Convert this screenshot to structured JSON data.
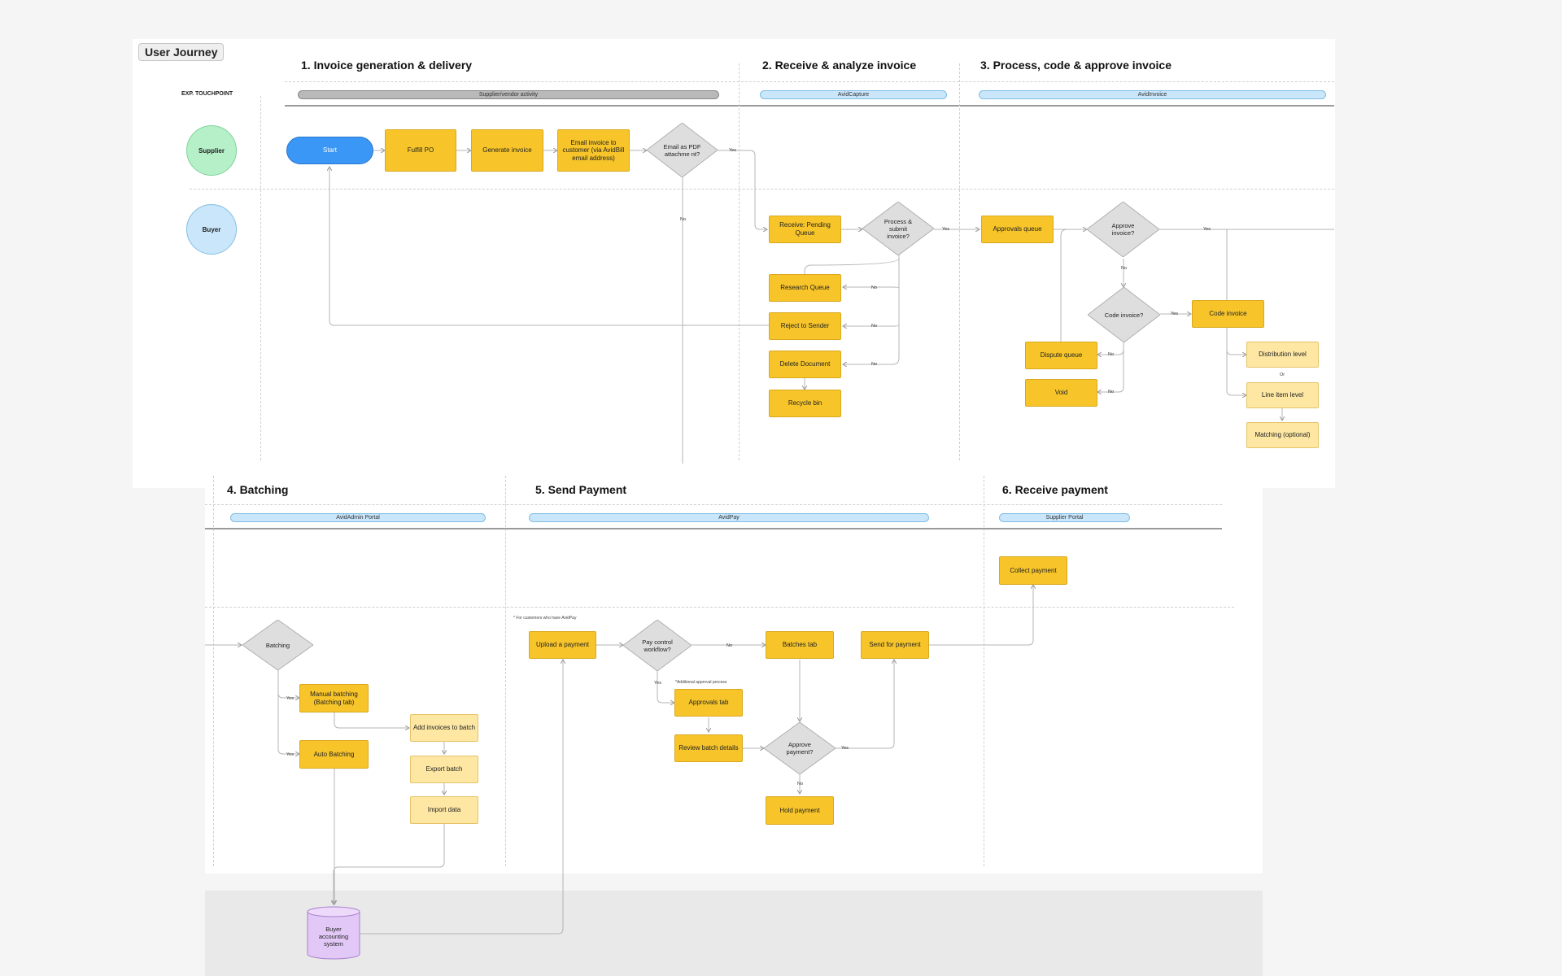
{
  "title": "User Journey",
  "touchpoint_label": "EXP. TOUCHPOINT",
  "actors": {
    "supplier": "Supplier",
    "buyer": "Buyer"
  },
  "phases": {
    "p1": "1. Invoice generation & delivery",
    "p2": "2. Receive & analyze invoice",
    "p3": "3. Process, code & approve invoice",
    "p4": "4. Batching",
    "p5": "5. Send Payment",
    "p6": "6. Receive payment"
  },
  "touchpoints": {
    "t1": "Supplier/vendor activity",
    "t2": "AvidCapture",
    "t3": "AvidInvoice",
    "t4": "AvidAdmin Portal",
    "t5": "AvidPay",
    "t6": "Supplier Portal"
  },
  "nodes": {
    "start": "Start",
    "fulfill_po": "Fulfill PO",
    "generate_invoice": "Generate invoice",
    "email_invoice": "Email invoice to customer (via AvidBill email address)",
    "email_pdf": "Email as PDF attachme nt?",
    "receive_pending": "Receive: Pending Queue",
    "process_submit": "Process & submit invoice?",
    "research_queue": "Research Queue",
    "reject_sender": "Reject to Sender",
    "delete_document": "Delete Document",
    "recycle_bin": "Recycle bin",
    "approvals_queue": "Approvals queue",
    "approve_invoice": "Approve invoice?",
    "code_invoice_q": "Code invoice?",
    "code_invoice": "Code invoice",
    "dispute_queue": "Dispute queue",
    "void": "Void",
    "distribution_level": "Distribution level",
    "line_item_level": "Line item level",
    "matching": "Matching (optional)",
    "batching": "Batching",
    "manual_batching": "Manual batching (Batching tab)",
    "auto_batching": "Auto Batching",
    "add_invoices": "Add invoices to batch",
    "export_batch": "Export batch",
    "import_data": "Import data",
    "buyer_accounting": "Buyer accounting system",
    "upload_payment": "Upload a payment",
    "pay_control": "Pay control workflow?",
    "batches_tab": "Batches tab",
    "send_payment": "Send for payment",
    "approvals_tab": "Approvals tab",
    "review_batch": "Review batch details",
    "approve_payment": "Approve payment?",
    "hold_payment": "Hold payment",
    "collect_payment": "Collect payment"
  },
  "edge_labels": {
    "yes": "Yes",
    "no": "No",
    "or": "Or"
  },
  "notes": {
    "avidpay_customers": "* For customers who have AvidPay",
    "additional_approval": "*Additional approval process"
  },
  "colors": {
    "process": "#f7c52a",
    "process_light": "#fde7a3",
    "decision": "#dedede",
    "start": "#3b97f5",
    "supplier": "#b6f0c8",
    "buyer": "#c9e6fb",
    "database": "#e2c8f7"
  }
}
